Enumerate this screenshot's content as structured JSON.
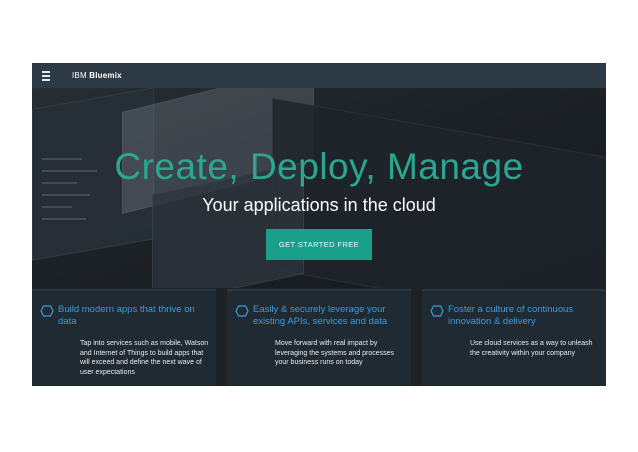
{
  "topbar": {
    "brand_prefix": "IBM",
    "brand_name": "Bluemix"
  },
  "hero": {
    "title": "Create, Deploy, Manage",
    "subtitle": "Your applications in the cloud",
    "cta_label": "GET STARTED FREE"
  },
  "cards": [
    {
      "heading": "Build modern apps that thrive on data",
      "body": "Tap into services such as mobile, Watson and Internet of Things to build apps that will exceed and define the next wave of user expectations"
    },
    {
      "heading": "Easily & securely leverage your existing APIs, services and data",
      "body": "Move forward with real impact by leveraging the systems and processes your business runs on today"
    },
    {
      "heading": "Foster a culture of continuous innovation & delivery",
      "body": "Use cloud services as a way to unleash the creativity within your company"
    }
  ],
  "colors": {
    "accent_teal": "#2aa791",
    "cta_background": "#18a08a",
    "card_heading_blue": "#3b9cda",
    "topbar": "#2d3a45",
    "card_background": "#1f2a33"
  },
  "icons": {
    "menu": "hamburger-menu-icon",
    "card": "hexagon-icon"
  }
}
